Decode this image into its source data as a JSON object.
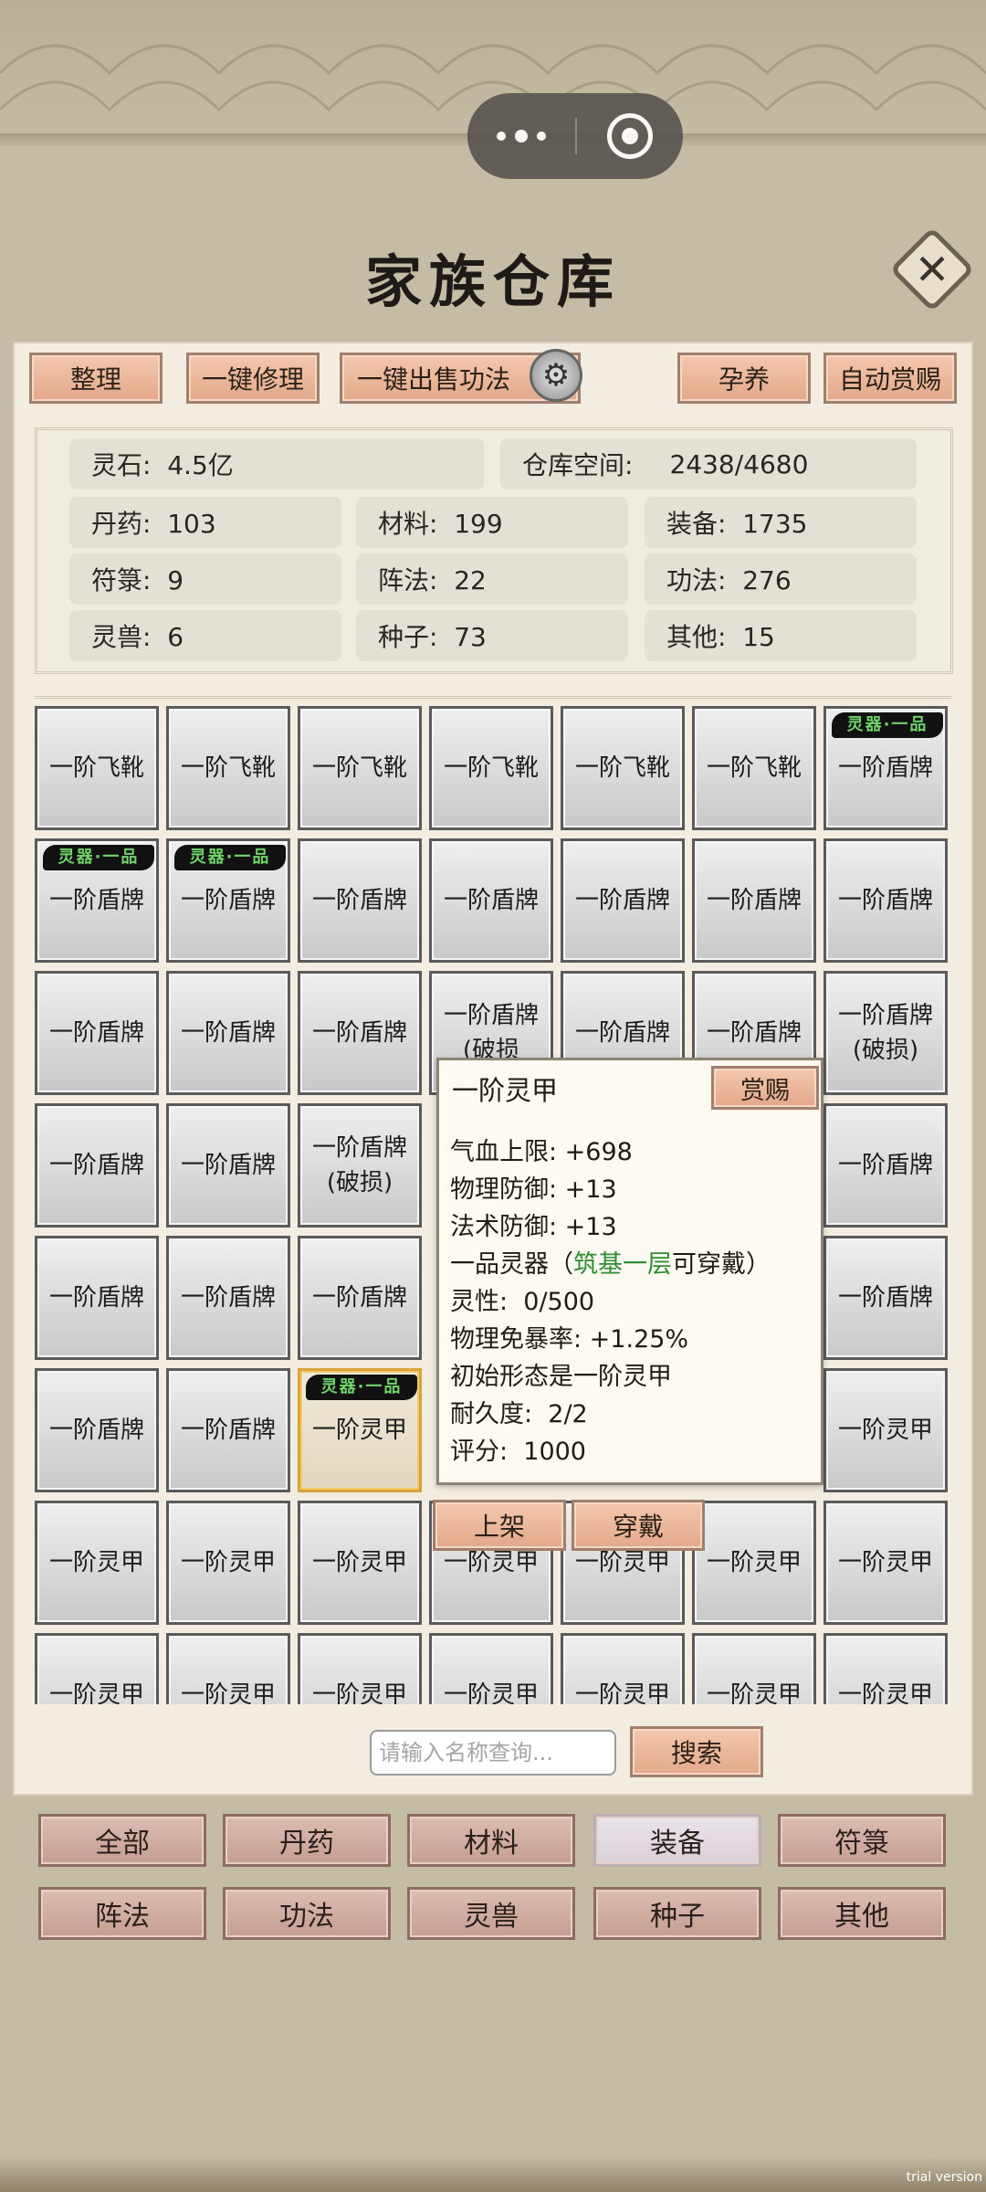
{
  "header": {
    "title": "家族仓库",
    "close_label": "✕"
  },
  "toolbar": {
    "sort": "整理",
    "repair_all": "一键修理",
    "sell_skills": "一键出售功法",
    "nurture": "孕养",
    "auto_reward": "自动赏赐"
  },
  "stats": {
    "spirit_stone": "灵石:  4.5亿",
    "warehouse_space_label": "仓库空间:",
    "warehouse_space_value": "2438/4680",
    "pills": "丹药:  103",
    "materials": "材料:  199",
    "equipment": "装备:  1735",
    "talismans": "符箓:  9",
    "formations": "阵法:  22",
    "skills": "功法:  276",
    "beasts": "灵兽:  6",
    "seeds": "种子:  73",
    "others": "其他:  15"
  },
  "grid": {
    "tag": "灵器·一品",
    "rows": [
      [
        "一阶飞靴",
        "一阶飞靴",
        "一阶飞靴",
        "一阶飞靴",
        "一阶飞靴",
        "一阶飞靴",
        "一阶盾牌"
      ],
      [
        "一阶盾牌",
        "一阶盾牌",
        "一阶盾牌",
        "一阶盾牌",
        "一阶盾牌",
        "一阶盾牌",
        "一阶盾牌"
      ],
      [
        "一阶盾牌",
        "一阶盾牌",
        "一阶盾牌",
        "一阶盾牌",
        "一阶盾牌",
        "一阶盾牌",
        "一阶盾牌"
      ],
      [
        "一阶盾牌",
        "一阶盾牌",
        "一阶盾牌",
        "",
        "",
        "",
        "一阶盾牌"
      ],
      [
        "一阶盾牌",
        "一阶盾牌",
        "一阶盾牌",
        "",
        "",
        "",
        "一阶盾牌"
      ],
      [
        "一阶盾牌",
        "一阶盾牌",
        "一阶灵甲",
        "",
        "",
        "",
        "一阶灵甲"
      ],
      [
        "一阶灵甲",
        "一阶灵甲",
        "一阶灵甲",
        "一阶灵甲",
        "一阶灵甲",
        "一阶灵甲",
        "一阶灵甲"
      ],
      [
        "一阶灵甲",
        "一阶灵甲",
        "一阶灵甲",
        "一阶灵甲",
        "一阶灵甲",
        "一阶灵甲",
        "一阶灵甲"
      ]
    ],
    "damaged_suffix": "(破损)",
    "damaged_partial": "(破损"
  },
  "tooltip": {
    "name": "一阶灵甲",
    "reward_button": "赏赐",
    "hp": "气血上限: +698",
    "phys_def": "物理防御: +13",
    "magic_def": "法术防御: +13",
    "grade_prefix": "一品灵器（",
    "grade_req": "筑基一层",
    "grade_suffix": "可穿戴）",
    "spirit": "灵性:  0/500",
    "crit_res": "物理免暴率: +1.25%",
    "origin": "初始形态是一阶灵甲",
    "durability": "耐久度:  2/2",
    "score": "评分:  1000",
    "list_button": "上架",
    "equip_button": "穿戴"
  },
  "search": {
    "placeholder": "请输入名称查询...",
    "button": "搜索"
  },
  "filters": {
    "row1": [
      "全部",
      "丹药",
      "材料",
      "装备",
      "符箓"
    ],
    "row2": [
      "阵法",
      "功法",
      "灵兽",
      "种子",
      "其他"
    ],
    "active": "装备"
  },
  "watermark": "trial version"
}
